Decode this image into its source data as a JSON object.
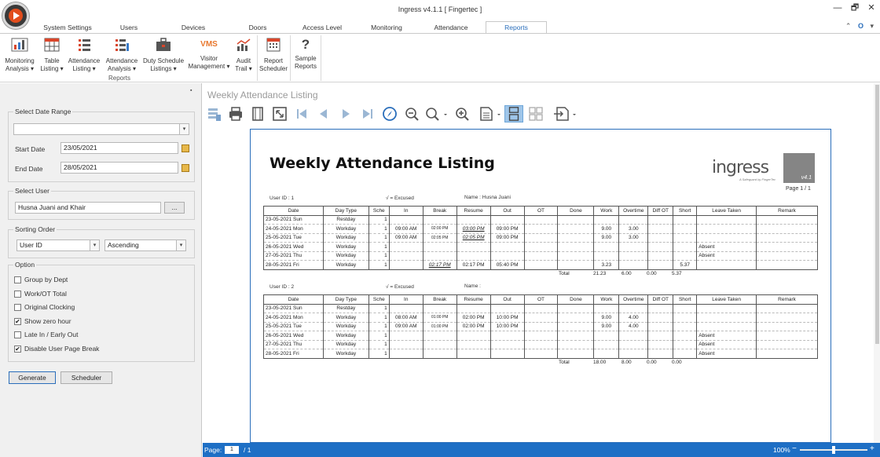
{
  "window": {
    "title": "Ingress v4.1.1 [ Fingertec ]",
    "minimize": "—",
    "restore": "🗗",
    "close": "✕"
  },
  "tabs": [
    "System Settings",
    "Users",
    "Devices",
    "Doors",
    "Access Level",
    "Monitoring",
    "Attendance",
    "Reports"
  ],
  "active_tab": "Reports",
  "ribbon": {
    "buttons": [
      {
        "label1": "Monitoring",
        "label2": "Analysis ▾",
        "icon": "bar-chart-icon"
      },
      {
        "label1": "Table",
        "label2": "Listing ▾",
        "icon": "table-icon"
      },
      {
        "label1": "Attendance",
        "label2": "Listing ▾",
        "icon": "list-icon"
      },
      {
        "label1": "Attendance",
        "label2": "Analysis ▾",
        "icon": "list-analysis-icon"
      },
      {
        "label1": "Duty Schedule",
        "label2": "Listings ▾",
        "icon": "briefcase-icon"
      },
      {
        "label1": "Visitor",
        "label2": "Management ▾",
        "icon": "vms-icon",
        "icon_text": "VMS"
      },
      {
        "label1": "Audit",
        "label2": "Trail ▾",
        "icon": "trend-chart-icon"
      },
      {
        "label1": "Report",
        "label2": "Scheduler",
        "icon": "calendar-icon"
      },
      {
        "label1": "Sample",
        "label2": "Reports",
        "icon": "question-icon",
        "icon_text": "?"
      }
    ],
    "group_label": "Reports"
  },
  "left": {
    "date_range": {
      "legend": "Select Date Range",
      "preset": "",
      "start_label": "Start Date",
      "start": "23/05/2021",
      "end_label": "End Date",
      "end": "28/05/2021"
    },
    "user": {
      "legend": "Select User",
      "value": "Husna Juani and Khair",
      "browse": "..."
    },
    "sorting": {
      "legend": "Sorting Order",
      "field": "User ID",
      "direction": "Ascending"
    },
    "option": {
      "legend": "Option",
      "items": [
        {
          "label": "Group by Dept",
          "checked": false
        },
        {
          "label": "Work/OT Total",
          "checked": false
        },
        {
          "label": "Original Clocking",
          "checked": false
        },
        {
          "label": "Show zero hour",
          "checked": true
        },
        {
          "label": "Late In / Early Out",
          "checked": false
        },
        {
          "label": "Disable User Page Break",
          "checked": true
        }
      ]
    },
    "generate": "Generate",
    "scheduler": "Scheduler",
    "pin": "▪"
  },
  "report": {
    "viewer_title": "Weekly Attendance Listing",
    "heading": "Weekly Attendance Listing",
    "logo_word": "ingress",
    "logo_version": "v4.1",
    "logo_sub": "A Safeguard by FingerTec",
    "page": "Page 1 / 1",
    "columns": [
      "Date",
      "Day Type",
      "Sche",
      "In",
      "Break",
      "Resume",
      "Out",
      "OT",
      "Done",
      "Work",
      "Overtime",
      "Diff OT",
      "Short",
      "Leave Taken",
      "Remark"
    ],
    "sections": [
      {
        "user_id": "User ID : 1",
        "excused": "√ = Excused",
        "name": "Name : Husna Juani",
        "rows": [
          [
            "23-05-2021 Sun",
            "Restday",
            "1",
            "",
            "",
            "",
            "",
            "",
            "",
            "",
            "",
            "",
            "",
            "",
            ""
          ],
          [
            "24-05-2021 Mon",
            "Workday",
            "1",
            "09:00 AM",
            "02:00 PM",
            "03:00 PM",
            "09:00 PM",
            "",
            "",
            "9.00",
            "3.00",
            "",
            "",
            "",
            ""
          ],
          [
            "25-05-2021 Tue",
            "Workday",
            "1",
            "09:00 AM",
            "02:05 PM",
            "02:05 PM",
            "09:00 PM",
            "",
            "",
            "9.00",
            "3.00",
            "",
            "",
            "",
            ""
          ],
          [
            "26-05-2021 Wed",
            "Workday",
            "1",
            "",
            "",
            "",
            "",
            "",
            "",
            "",
            "",
            "",
            "",
            "Absent",
            ""
          ],
          [
            "27-05-2021 Thu",
            "Workday",
            "1",
            "",
            "",
            "",
            "",
            "",
            "",
            "",
            "",
            "",
            "",
            "Absent",
            ""
          ],
          [
            "28-05-2021 Fri",
            "Workday",
            "1",
            "",
            "02:17 PM",
            "02:17 PM",
            "05:40 PM",
            "",
            "",
            "3.23",
            "",
            "",
            "5.37",
            "",
            ""
          ]
        ],
        "total_label": "Total",
        "total_work": "21.23",
        "total_ot": "6.00",
        "total_diff": "0.00",
        "total_short": "5.37"
      },
      {
        "user_id": "User ID : 2",
        "excused": "√ = Excused",
        "name": "Name :",
        "rows": [
          [
            "23-05-2021 Sun",
            "Restday",
            "1",
            "",
            "",
            "",
            "",
            "",
            "",
            "",
            "",
            "",
            "",
            "",
            ""
          ],
          [
            "24-05-2021 Mon",
            "Workday",
            "1",
            "08:00 AM",
            "01:00 PM",
            "02:00 PM",
            "10:00 PM",
            "",
            "",
            "9.00",
            "4.00",
            "",
            "",
            "",
            ""
          ],
          [
            "25-05-2021 Tue",
            "Workday",
            "1",
            "09:00 AM",
            "01:00 PM",
            "02:00 PM",
            "10:00 PM",
            "",
            "",
            "9.00",
            "4.00",
            "",
            "",
            "",
            ""
          ],
          [
            "26-05-2021 Wed",
            "Workday",
            "1",
            "",
            "",
            "",
            "",
            "",
            "",
            "",
            "",
            "",
            "",
            "Absent",
            ""
          ],
          [
            "27-05-2021 Thu",
            "Workday",
            "1",
            "",
            "",
            "",
            "",
            "",
            "",
            "",
            "",
            "",
            "",
            "Absent",
            ""
          ],
          [
            "28-05-2021 Fri",
            "Workday",
            "1",
            "",
            "",
            "",
            "",
            "",
            "",
            "",
            "",
            "",
            "",
            "Absent",
            ""
          ]
        ],
        "total_label": "Total",
        "total_work": "18.00",
        "total_ot": "8.00",
        "total_diff": "0.00",
        "total_short": "0.00"
      }
    ],
    "red_cells": [
      "0-1-5",
      "0-2-5",
      "0-5-4"
    ],
    "small_cells": [
      "0-1-4",
      "0-2-4",
      "1-1-4",
      "1-2-4"
    ]
  },
  "status": {
    "page_label": "Page:",
    "page_value": "1",
    "page_of": "/ 1",
    "zoom": "100%",
    "zoom_minus": "−",
    "zoom_plus": "+"
  },
  "colors": {
    "accent": "#1e6fc5",
    "active_tool": "#9fc6ea",
    "brand_orange": "#e24d1c"
  }
}
